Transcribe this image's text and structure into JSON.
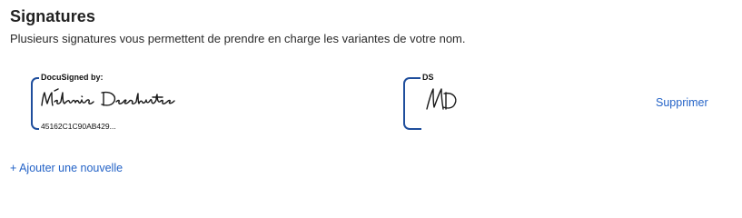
{
  "section": {
    "title": "Signatures",
    "description": "Plusieurs signatures vous permettent de prendre en charge les variantes de votre nom."
  },
  "signature_full": {
    "label": "DocuSigned by:",
    "signed_name": "Mélanie Deschutes",
    "envelope_id": "45162C1C90AB429..."
  },
  "signature_initials": {
    "label": "DS",
    "signed_initials": "MD"
  },
  "actions": {
    "delete_label": "Supprimer",
    "add_label": "+ Ajouter une nouvelle"
  },
  "colors": {
    "bracket": "#1f4e9c",
    "link": "#2463c7"
  }
}
